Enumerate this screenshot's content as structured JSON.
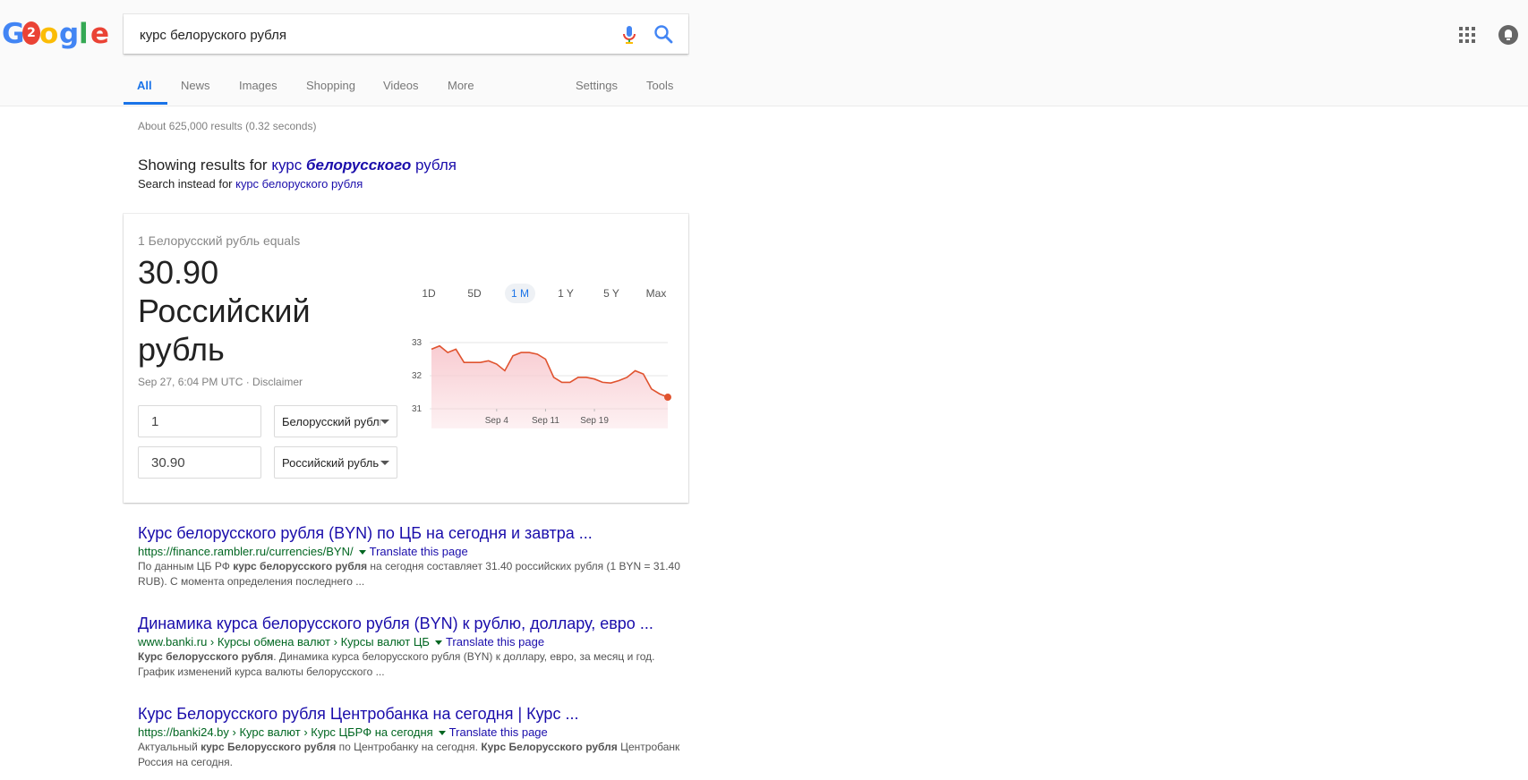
{
  "search": {
    "query": "курс белоруского рубля"
  },
  "logo": {
    "letters": [
      "G",
      "2",
      "o",
      "g",
      "l",
      "e"
    ]
  },
  "icons": {
    "mic": "microphone-icon",
    "search": "search-icon",
    "apps": "apps-grid-icon",
    "notifications": "bell-icon"
  },
  "tabs": {
    "all": "All",
    "news": "News",
    "images": "Images",
    "shopping": "Shopping",
    "videos": "Videos",
    "more": "More",
    "settings": "Settings",
    "tools": "Tools"
  },
  "result_stats": "About 625,000 results (0.32 seconds)",
  "spelling": {
    "showing_prefix": "Showing results for",
    "corrected_before": "курс",
    "corrected_bold": "белорусского",
    "corrected_after": "рубля",
    "instead_prefix": "Search instead for",
    "original_query": "курс белоруского рубля"
  },
  "currency_card": {
    "equals_label": "1 Белорусский рубль equals",
    "value": "30.90 Российский рубль",
    "updated": "Sep 27, 6:04 PM UTC · Disclaimer",
    "from_amount": "1",
    "from_currency": "Белорусский рубль",
    "to_amount": "30.90",
    "to_currency": "Российский рубль",
    "ranges": [
      "1D",
      "5D",
      "1 M",
      "1 Y",
      "5 Y",
      "Max"
    ],
    "active_range": "1 M"
  },
  "chart_data": {
    "type": "area",
    "y_ticks": [
      "33",
      "32",
      "31"
    ],
    "x_ticks": [
      "Sep 4",
      "Sep 11",
      "Sep 19"
    ],
    "ylim": [
      31,
      33
    ],
    "values": [
      32.8,
      32.9,
      32.7,
      32.8,
      32.4,
      32.4,
      32.4,
      32.45,
      32.35,
      32.15,
      32.6,
      32.7,
      32.7,
      32.65,
      32.5,
      31.95,
      31.8,
      31.8,
      31.95,
      31.95,
      31.9,
      31.8,
      31.78,
      31.85,
      31.95,
      32.15,
      32.05,
      31.6,
      31.45,
      31.35
    ],
    "colors": {
      "line": "#e0532f",
      "fill": "#f8c9cf",
      "grid": "#e6e6e6"
    }
  },
  "results": [
    {
      "title": "Курс белорусского рубля (BYN) по ЦБ на сегодня и завтра ...",
      "cite": "https://finance.rambler.ru/currencies/BYN/",
      "translate": "Translate this page",
      "snippet_parts": [
        {
          "t": "По данным ЦБ РФ ",
          "b": false
        },
        {
          "t": "курс белорусского рубля",
          "b": true
        },
        {
          "t": " на сегодня составляет 31.40 российских рубля (1 BYN = 31.40 RUB). С момента определения последнего ...",
          "b": false
        }
      ]
    },
    {
      "title": "Динамика курса белорусского рубля (BYN) к рублю, доллару, евро ...",
      "cite": "www.banki.ru › Курсы обмена валют › Курсы валют ЦБ",
      "translate": "Translate this page",
      "snippet_parts": [
        {
          "t": "Курс белорусского",
          "b": true
        },
        {
          "t": " ",
          "b": false
        },
        {
          "t": "рубля",
          "b": true
        },
        {
          "t": ". Динамика курса белорусского рубля (BYN) к доллару, евро, за месяц и год. График изменений курса валюты белорусского ...",
          "b": false
        }
      ]
    },
    {
      "title": "Курс Белорусского рубля Центробанка на сегодня | Курс ...",
      "cite": "https://banki24.by › Курс валют › Курс ЦБРФ на сегодня",
      "translate": "Translate this page",
      "snippet_parts": [
        {
          "t": "Актуальный ",
          "b": false
        },
        {
          "t": "курс Белорусского рубля",
          "b": true
        },
        {
          "t": " по Центробанку на сегодня. ",
          "b": false
        },
        {
          "t": "Курс Белорусского рубля",
          "b": true
        },
        {
          "t": " Центробанк Россия на сегодня.",
          "b": false
        }
      ]
    }
  ]
}
